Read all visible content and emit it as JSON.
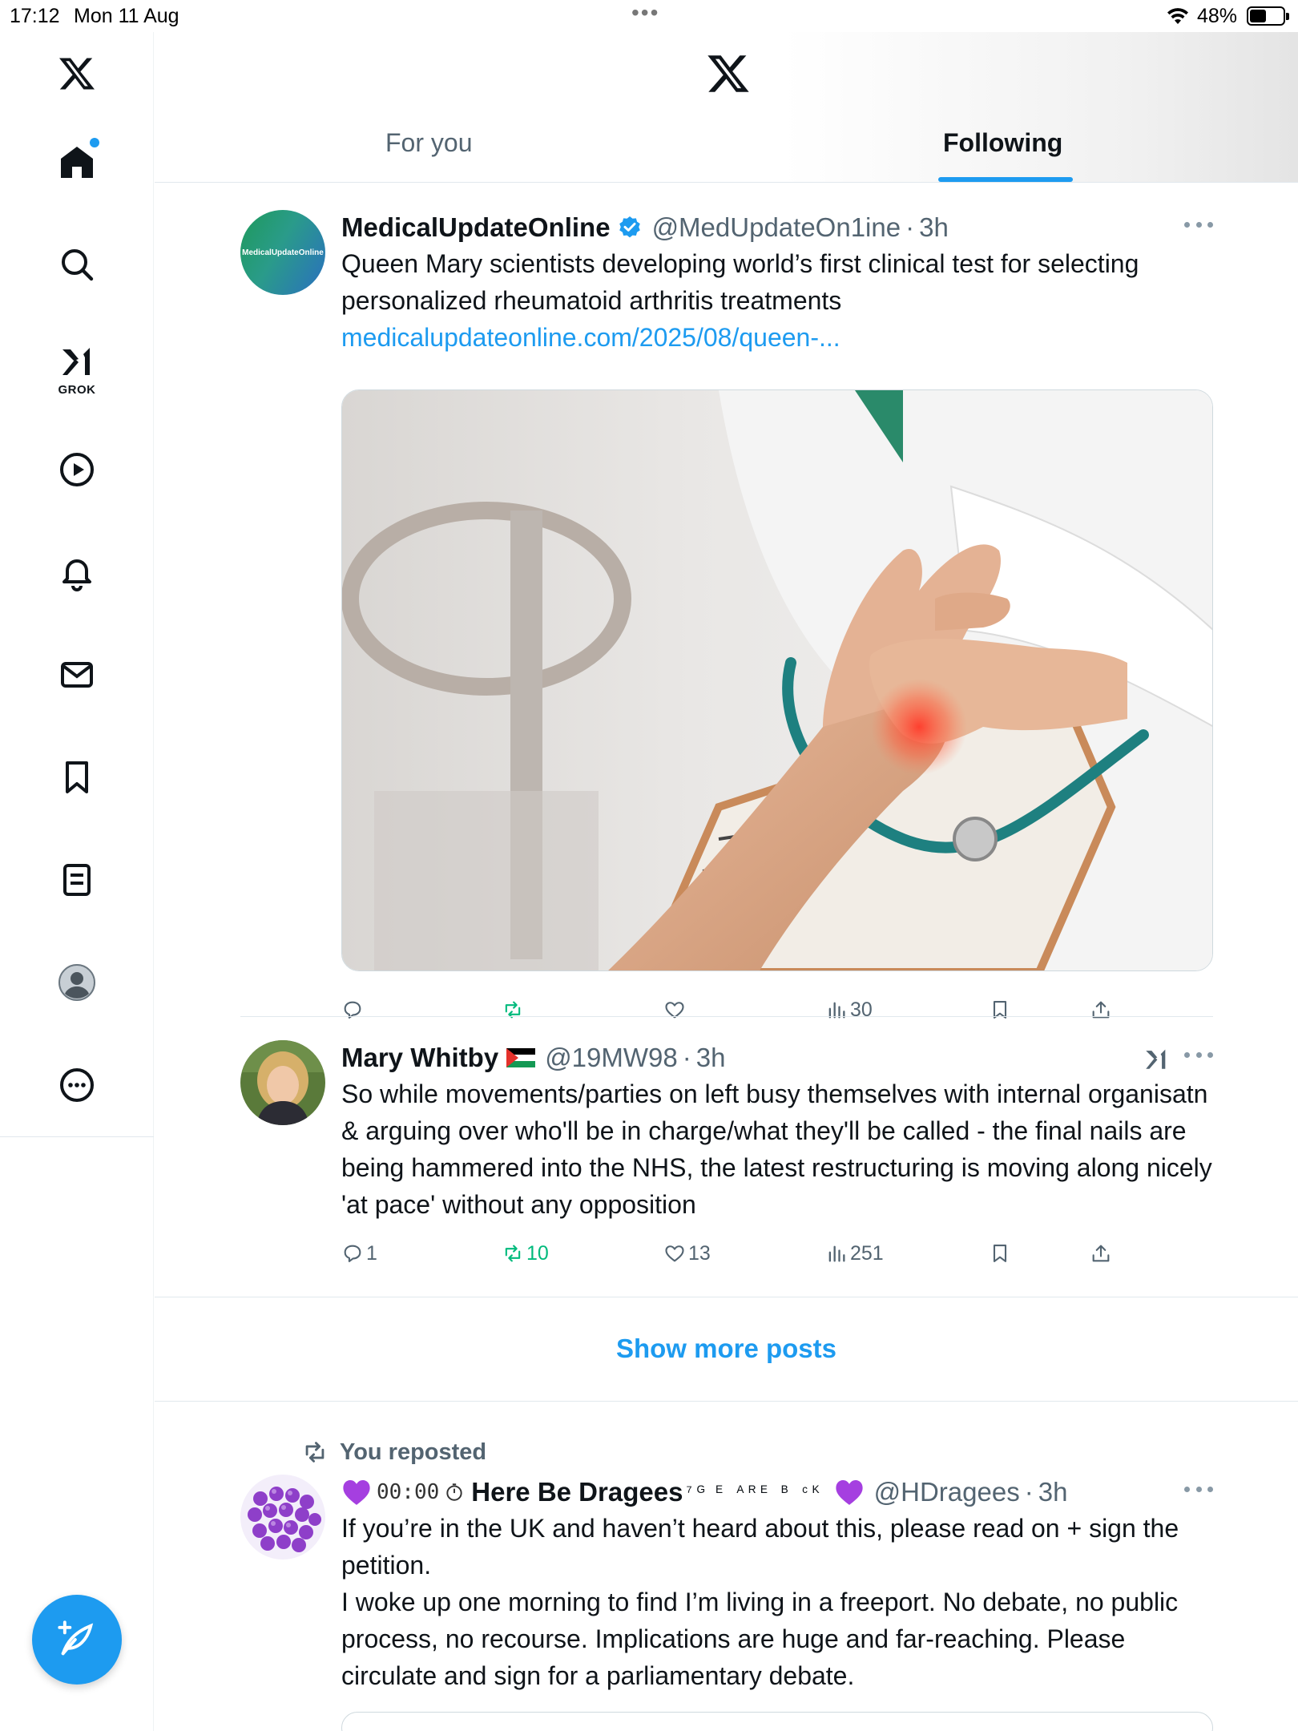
{
  "status_bar": {
    "time": "17:12",
    "date": "Mon 11 Aug",
    "dots": "•••",
    "battery_percent": "48%"
  },
  "sidebar": {
    "items": [
      "home",
      "explore",
      "grok",
      "video",
      "notifications",
      "messages",
      "bookmarks",
      "lists",
      "profile",
      "more"
    ],
    "grok_label": "GROK"
  },
  "header": {
    "tabs": [
      {
        "label": "For you",
        "active": false
      },
      {
        "label": "Following",
        "active": true
      }
    ]
  },
  "posts": [
    {
      "display_name": "MedicalUpdateOnline",
      "handle": "@MedUpdateOn1ine",
      "separator": "·",
      "time": "3h",
      "verified": true,
      "avatar_text": "MedicalUpdateOnline",
      "text": "Queen Mary scientists developing world’s first clinical test for selecting personalized rheumatoid arthritis treatments",
      "link": "medicalupdateonline.com/2025/08/queen-...",
      "replies": "",
      "reposts": "",
      "likes": "",
      "views": "30"
    },
    {
      "display_name": "Mary Whitby",
      "flag": "🇵🇸",
      "handle": "@19MW98",
      "separator": "·",
      "time": "3h",
      "text": "So while movements/parties on left busy themselves with internal organisatn & arguing over who'll be in charge/what they'll be called - the final nails are being hammered into the NHS, the latest restructuring is moving along nicely 'at pace' without any opposition",
      "replies": "1",
      "reposts": "10",
      "likes": "13",
      "views": "251"
    }
  ],
  "show_more": "Show more posts",
  "repost_post": {
    "reposted_label": "You reposted",
    "name_prefix": "00:00",
    "display_name": "Here Be Dragees",
    "name_suffix": "⁷ᴳ",
    "name_fancy": "ᴱ ᴬᴿᴱ ᴮ ᶜᴷ",
    "handle": "@HDragees",
    "separator": "·",
    "time": "3h",
    "text_lines": [
      "If you’re in the UK and haven’t heard about this, please read on + sign the petition.",
      "I woke up one morning to find I’m living in a freeport. No debate, no public process, no recourse. Implications are huge and far-reaching. Please circulate and sign for a parliamentary debate."
    ]
  },
  "colors": {
    "accent": "#1d9bf0",
    "text_primary": "#0f1419",
    "text_secondary": "#536471",
    "repost_green": "#00ba7c",
    "border": "#e1e8ed"
  }
}
